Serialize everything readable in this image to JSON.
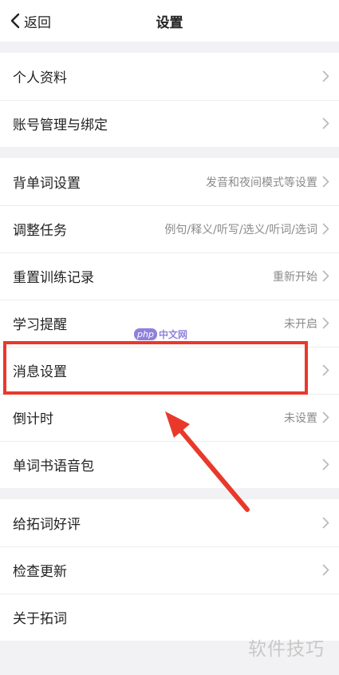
{
  "navbar": {
    "back_label": "返回",
    "title": "设置"
  },
  "groups": [
    {
      "items": [
        {
          "label": "个人资料",
          "value": ""
        },
        {
          "label": "账号管理与绑定",
          "value": ""
        }
      ]
    },
    {
      "items": [
        {
          "label": "背单词设置",
          "value": "发音和夜间模式等设置"
        },
        {
          "label": "调整任务",
          "value": "例句/释义/听写/选义/听词/选词"
        },
        {
          "label": "重置训练记录",
          "value": "重新开始"
        },
        {
          "label": "学习提醒",
          "value": "未开启"
        },
        {
          "label": "消息设置",
          "value": ""
        },
        {
          "label": "倒计时",
          "value": "未设置"
        },
        {
          "label": "单词书语音包",
          "value": ""
        }
      ]
    },
    {
      "items": [
        {
          "label": "给拓词好评",
          "value": ""
        },
        {
          "label": "检查更新",
          "value": ""
        },
        {
          "label": "关于拓词",
          "value": ""
        }
      ]
    }
  ],
  "watermark": {
    "logo_php": "php",
    "logo_cn": "中文网",
    "corner": "软件技巧"
  },
  "colors": {
    "annotation": "#e8392b",
    "chevron": "#b8b8b8",
    "value_text": "#8a8a8a"
  },
  "icons": {
    "back": "chevron-left-icon",
    "row_arrow": "chevron-right-icon"
  }
}
